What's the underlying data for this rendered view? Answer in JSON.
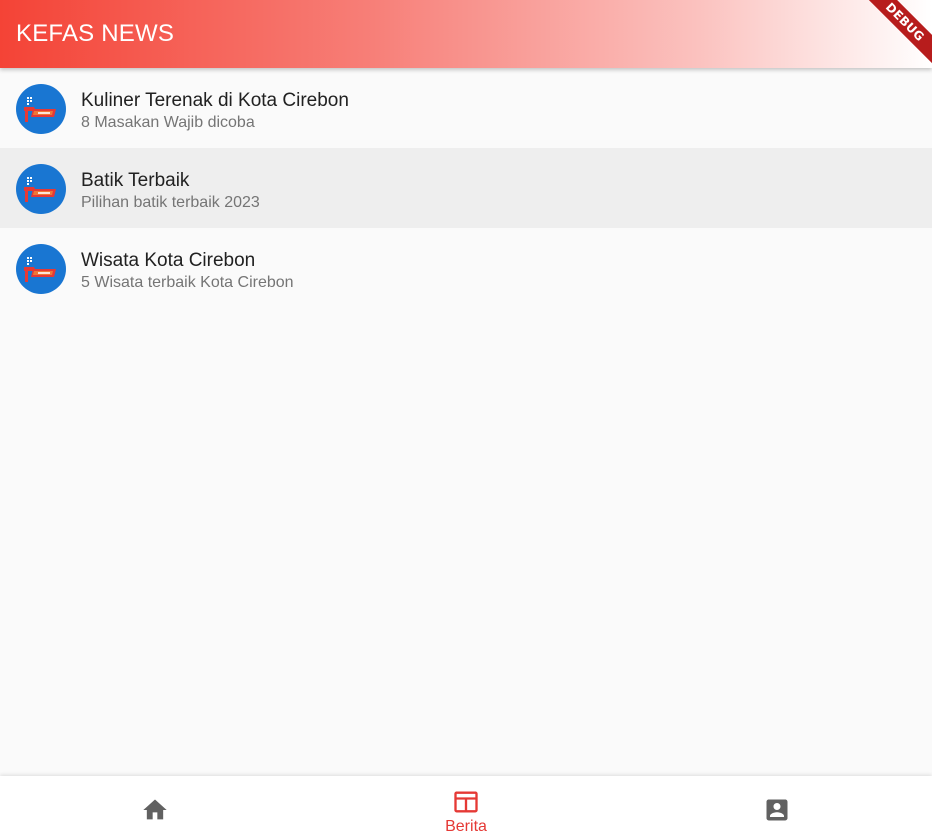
{
  "app": {
    "title": "KEFAS NEWS",
    "debug_banner": "DEBUG"
  },
  "colors": {
    "accent": "#f44336",
    "avatar_bg": "#1976d2",
    "nav_inactive": "#616161",
    "nav_active": "#e53935"
  },
  "news": {
    "items": [
      {
        "title": "Kuliner Terenak di Kota Cirebon",
        "subtitle": "8 Masakan Wajib dicoba",
        "icon": "news-logo-icon"
      },
      {
        "title": "Batik Terbaik",
        "subtitle": "Pilihan batik terbaik 2023",
        "icon": "news-logo-icon"
      },
      {
        "title": "Wisata Kota Cirebon",
        "subtitle": "5 Wisata terbaik Kota Cirebon",
        "icon": "news-logo-icon"
      }
    ]
  },
  "bottom_nav": {
    "items": [
      {
        "label": "",
        "icon": "home-icon",
        "active": false
      },
      {
        "label": "Berita",
        "icon": "newspaper-icon",
        "active": true
      },
      {
        "label": "",
        "icon": "account-box-icon",
        "active": false
      }
    ]
  }
}
